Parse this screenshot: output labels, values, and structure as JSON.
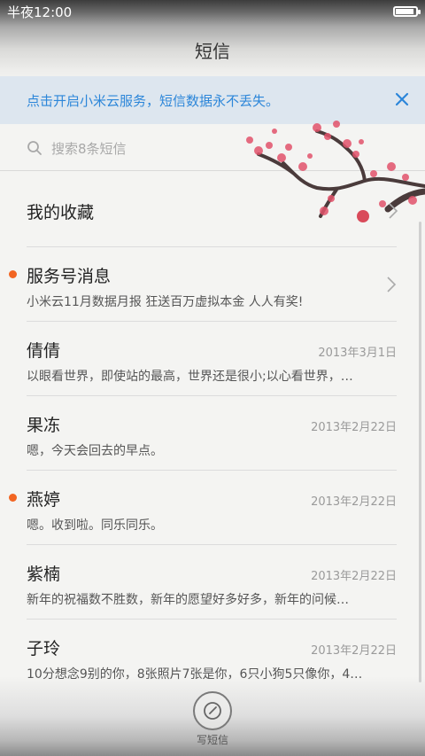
{
  "status_bar": {
    "time": "半夜12:00",
    "battery_level": 0.92
  },
  "header": {
    "title": "短信"
  },
  "banner": {
    "text": "点击开启小米云服务，短信数据永不丢失。",
    "accent": "#2c86d9"
  },
  "search": {
    "placeholder": "搜索8条短信"
  },
  "favorites": {
    "label": "我的收藏"
  },
  "conversations": [
    {
      "name": "服务号消息",
      "date": "",
      "preview": "小米云11月数据月报 狂送百万虚拟本金 人人有奖!",
      "unread": true,
      "has_chevron": true
    },
    {
      "name": "倩倩",
      "date": "2013年3月1日",
      "preview": "以眼看世界，即使站的最高，世界还是很小;以心看世界，…",
      "unread": false,
      "has_chevron": false
    },
    {
      "name": "果冻",
      "date": "2013年2月22日",
      "preview": "嗯，今天会回去的早点。",
      "unread": false,
      "has_chevron": false
    },
    {
      "name": "燕婷",
      "date": "2013年2月22日",
      "preview": "嗯。收到啦。同乐同乐。",
      "unread": true,
      "has_chevron": false
    },
    {
      "name": "紫楠",
      "date": "2013年2月22日",
      "preview": "新年的祝福数不胜数，新年的愿望好多好多，新年的问候…",
      "unread": false,
      "has_chevron": false
    },
    {
      "name": "子玲",
      "date": "2013年2月22日",
      "preview": "10分想念9别的你，8张照片7张是你，6只小狗5只像你，4…",
      "unread": false,
      "has_chevron": false
    }
  ],
  "compose": {
    "label": "写短信"
  },
  "colors": {
    "unread_dot": "#f26522",
    "blossom": "#e2536b",
    "branch": "#4a3b3b"
  }
}
